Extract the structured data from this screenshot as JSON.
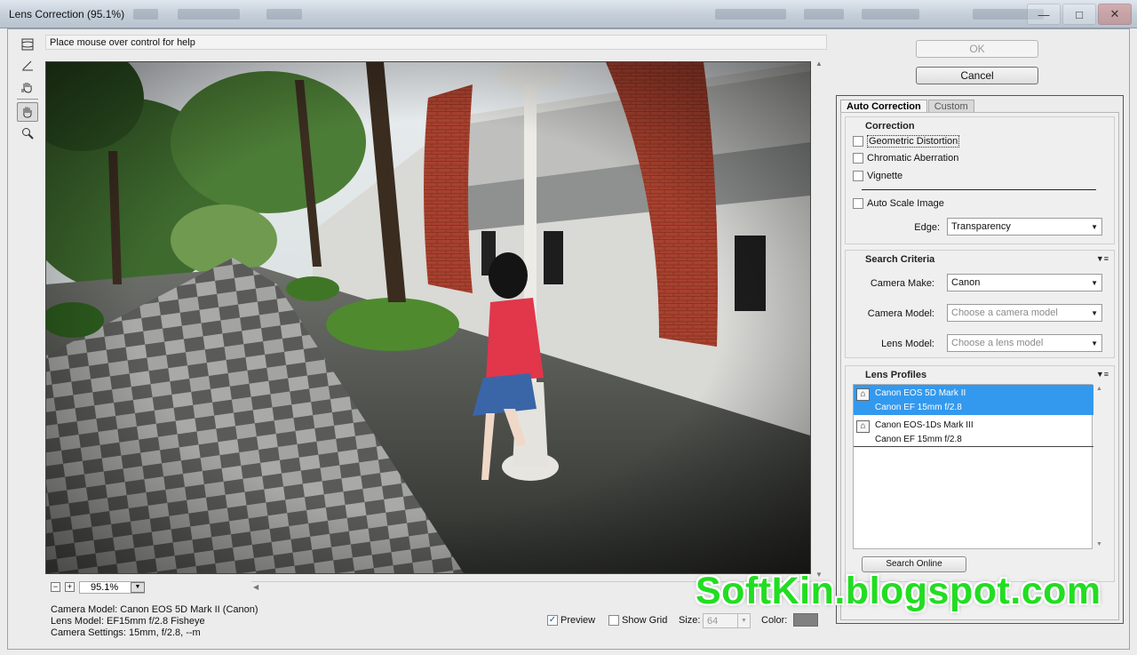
{
  "window": {
    "title": "Lens Correction (95.1%)",
    "controls": [
      "minimize-icon",
      "maximize-icon",
      "close-icon"
    ]
  },
  "help_text": "Place mouse over control for help",
  "tools": [
    "remove-distortion-tool-icon",
    "straighten-tool-icon",
    "move-grid-tool-icon",
    "hand-tool-icon",
    "zoom-tool-icon"
  ],
  "buttons": {
    "ok": "OK",
    "cancel": "Cancel"
  },
  "tabs": {
    "auto": "Auto Correction",
    "custom": "Custom"
  },
  "correction": {
    "title": "Correction",
    "geometric": "Geometric Distortion",
    "chromatic": "Chromatic Aberration",
    "vignette": "Vignette",
    "auto_scale": "Auto Scale Image",
    "edge_label": "Edge:",
    "edge_value": "Transparency",
    "checked": {
      "geometric": false,
      "chromatic": false,
      "vignette": false,
      "auto_scale": false
    }
  },
  "search_criteria": {
    "title": "Search Criteria",
    "make_label": "Camera Make:",
    "make_value": "Canon",
    "model_label": "Camera Model:",
    "model_placeholder": "Choose a camera model",
    "lens_label": "Lens Model:",
    "lens_placeholder": "Choose a lens model"
  },
  "lens_profiles": {
    "title": "Lens Profiles",
    "items": [
      {
        "camera": "Canon EOS 5D Mark II",
        "lens": "Canon EF 15mm f/2.8",
        "selected": true
      },
      {
        "camera": "Canon EOS-1Ds Mark III",
        "lens": "Canon EF 15mm f/2.8",
        "selected": false
      }
    ],
    "search_button": "Search Online"
  },
  "zoom": {
    "value": "95.1%"
  },
  "info": {
    "camera_model": "Camera Model: Canon EOS 5D Mark II (Canon)",
    "lens_model": "Lens Model: EF15mm f/2.8 Fisheye",
    "camera_settings": "Camera Settings: 15mm, f/2.8, --m"
  },
  "options": {
    "preview": "Preview",
    "preview_checked": true,
    "show_grid": "Show Grid",
    "show_grid_checked": false,
    "size_label": "Size:",
    "size_value": "64",
    "color_label": "Color:",
    "grid_color": "#808080"
  },
  "watermark": "SoftKin.blogspot.com"
}
